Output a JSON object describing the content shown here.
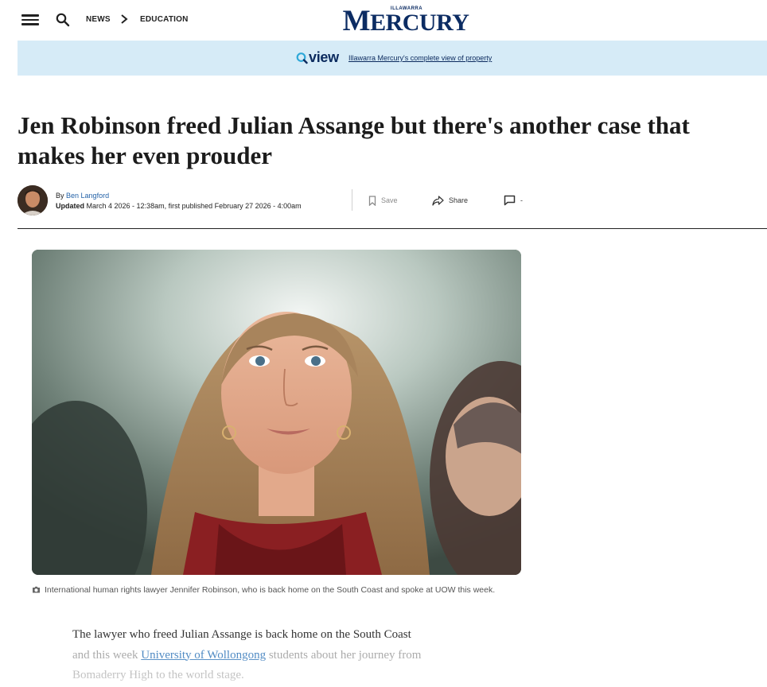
{
  "nav": {
    "crumb_1": "NEWS",
    "crumb_2": "EDUCATION",
    "logo_small": "ILLAWARRA",
    "logo_main_1": "M",
    "logo_main_2": "ERCURY"
  },
  "banner": {
    "brand": "view",
    "link": "Illawarra Mercury's complete view of property"
  },
  "article": {
    "headline": "Jen Robinson freed Julian Assange but there's another case that makes her even prouder",
    "by_prefix": "By",
    "author": "Ben Langford",
    "updated_label": "Updated",
    "updated_text": "March 4 2026 - 12:38am, first published February 27 2026 - 4:00am",
    "save_label": "Save",
    "share_label": "Share",
    "comments_count": "-",
    "caption": "International human rights lawyer Jennifer Robinson, who is back home on the South Coast and spoke at UOW this week.",
    "para_1": "The lawyer who freed Julian Assange is back home on the South Coast",
    "para_2a": "and this week",
    "para_2_link": "University of Wollongong",
    "para_2b": "students about her journey from",
    "para_3": "Bomaderry High to the world stage."
  },
  "colors": {
    "brand_navy": "#0c2c63",
    "banner_bg": "#d6ebf7",
    "link_blue": "#2563a8"
  }
}
